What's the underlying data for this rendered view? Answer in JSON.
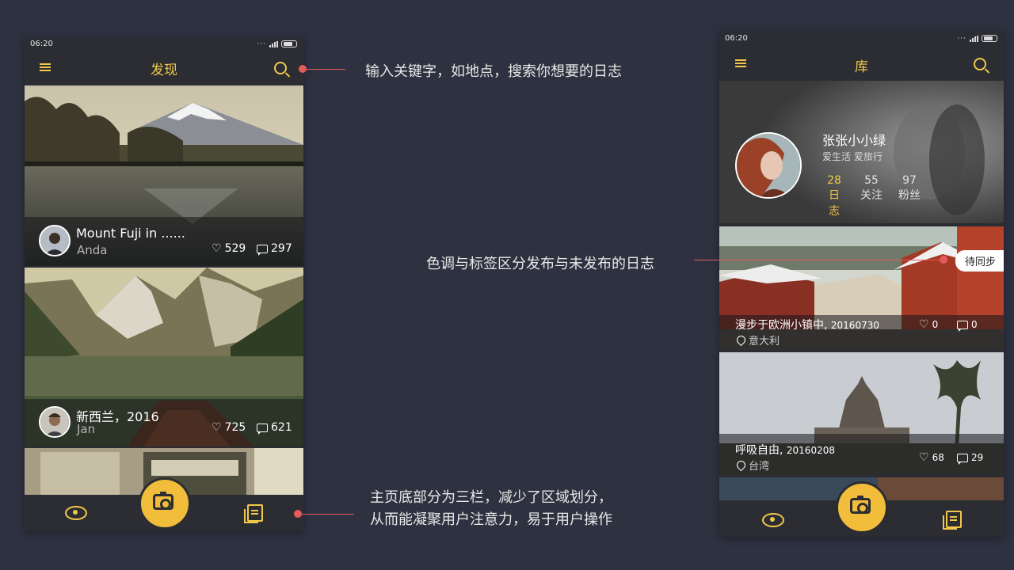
{
  "left_phone": {
    "status_time": "06:20",
    "title": "发现",
    "cards": [
      {
        "title": "Mount  Fuji  in  ......",
        "author": "Anda",
        "likes": "529",
        "comments": "297"
      },
      {
        "title": "新西兰，2016",
        "author": "Jan",
        "likes": "725",
        "comments": "621"
      }
    ]
  },
  "right_phone": {
    "status_time": "06:20",
    "title": "库",
    "profile": {
      "name": "张张小小绿",
      "tagline": "爱生活 爱旅行",
      "stats": [
        {
          "value": "28",
          "label": "日志"
        },
        {
          "value": "55",
          "label": "关注"
        },
        {
          "value": "97",
          "label": "粉丝"
        }
      ]
    },
    "cards": [
      {
        "title": "漫步于欧洲小镇中",
        "date": "20160730",
        "location": "意大利",
        "likes": "0",
        "comments": "0",
        "badge": "待同步"
      },
      {
        "title": "呼吸自由",
        "date": "20160208",
        "location": "台湾",
        "likes": "68",
        "comments": "29"
      }
    ]
  },
  "annotations": {
    "search": "输入关键字，如地点，搜索你想要的日志",
    "tone": "色调与标签区分发布与未发布的日志",
    "bottom_line1": "主页底部分为三栏，减少了区域划分，",
    "bottom_line2": "从而能凝聚用户注意力，易于用户操作"
  },
  "colors": {
    "background": "#2e3140",
    "accent": "#f2c84b",
    "pointer": "#e35b5b",
    "phone": "#2b2d33"
  }
}
